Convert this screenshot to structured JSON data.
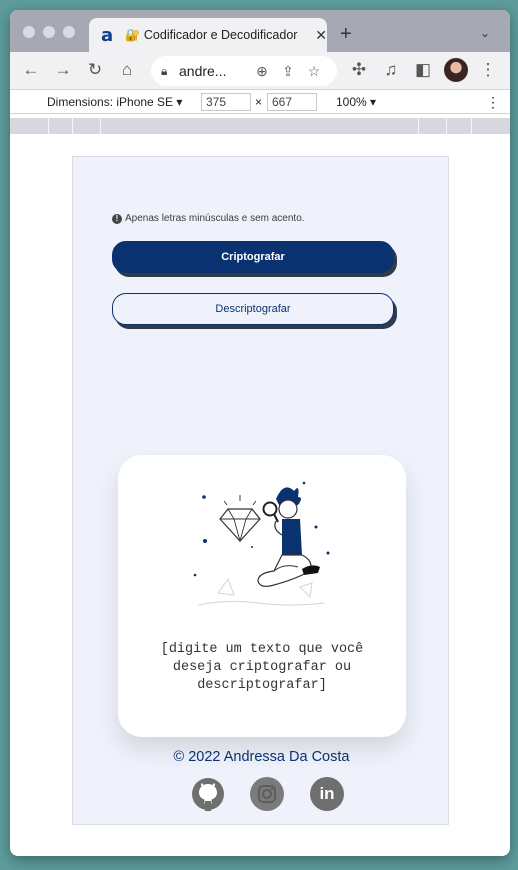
{
  "browser": {
    "tab": {
      "favicon": "a",
      "lock_emoji": "🔐",
      "title": "Codificador e Decodificador"
    },
    "address": "andre..."
  },
  "devtools": {
    "device_label": "Dimensions: iPhone SE ▾",
    "width": "375",
    "height": "667",
    "times": "×",
    "zoom": "100% ▾"
  },
  "app": {
    "hint_icon": "!",
    "hint": "Apenas letras minúsculas e sem acento.",
    "encrypt_button": "Criptografar",
    "decrypt_button": "Descriptografar",
    "placeholder_message": "[digite um texto que você deseja criptografar ou descriptografar]",
    "footer": "© 2022 Andressa Da Costa",
    "social_linkedin": "in"
  },
  "colors": {
    "primary": "#0a3270",
    "background": "#eff2fb"
  }
}
